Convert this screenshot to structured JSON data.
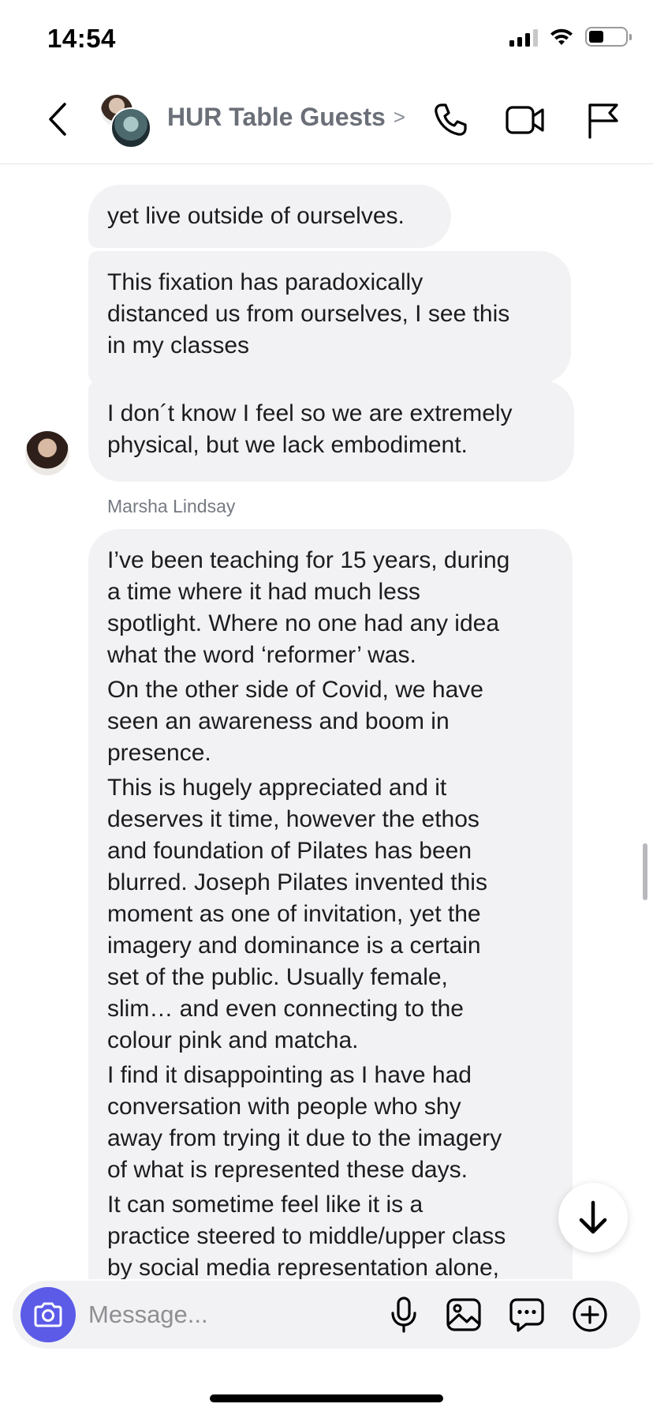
{
  "status_bar": {
    "time": "14:54",
    "battery_level": 0.4
  },
  "header": {
    "title": "HUR Table Guests",
    "chevron": ">"
  },
  "messages": {
    "m1": "yet live outside of ourselves.",
    "m2": [
      "This fixation has paradoxically",
      "distanced us from ourselves, I see this",
      "in my classes"
    ],
    "m3": [
      "I don´t know I feel so we are extremely",
      "physical, but we lack embodiment."
    ],
    "sender_name": "Marsha Lindsay",
    "m4": {
      "p1": [
        "I’ve been teaching for 15 years, during",
        "a time where it had much less",
        "spotlight. Where no one had any idea",
        "what the word ‘reformer’ was."
      ],
      "p2": [
        "On the other side of Covid, we have",
        "seen an awareness and boom in",
        "presence."
      ],
      "p3": [
        "This is hugely appreciated and it",
        "deserves it time, however the ethos",
        "and foundation of Pilates has been",
        "blurred. Joseph Pilates invented this",
        "moment as one of invitation, yet the",
        "imagery and dominance is a certain",
        "set of the public. Usually female,",
        "slim… and even connecting to the",
        "colour pink and matcha."
      ],
      "p4": [
        "I find it disappointing as I have had",
        "conversation with people who shy",
        "away from trying it due to the imagery",
        "of what is represented these days."
      ],
      "p5": [
        "It can sometime feel like it is a",
        "practice steered to middle/upper class",
        "by social media representation alone,"
      ]
    }
  },
  "composer": {
    "placeholder": "Message..."
  },
  "icons": {
    "back": "chevron-left-icon",
    "call": "phone-icon",
    "video": "video-camera-icon",
    "flag": "flag-icon",
    "camera": "camera-icon",
    "mic": "microphone-icon",
    "gallery": "image-icon",
    "sticker": "chat-bubble-icon",
    "plus": "plus-circle-icon",
    "scroll": "arrow-down-icon"
  },
  "colors": {
    "accent": "#5b5be8",
    "bubble": "#f2f2f4",
    "title": "#6b6f78"
  }
}
